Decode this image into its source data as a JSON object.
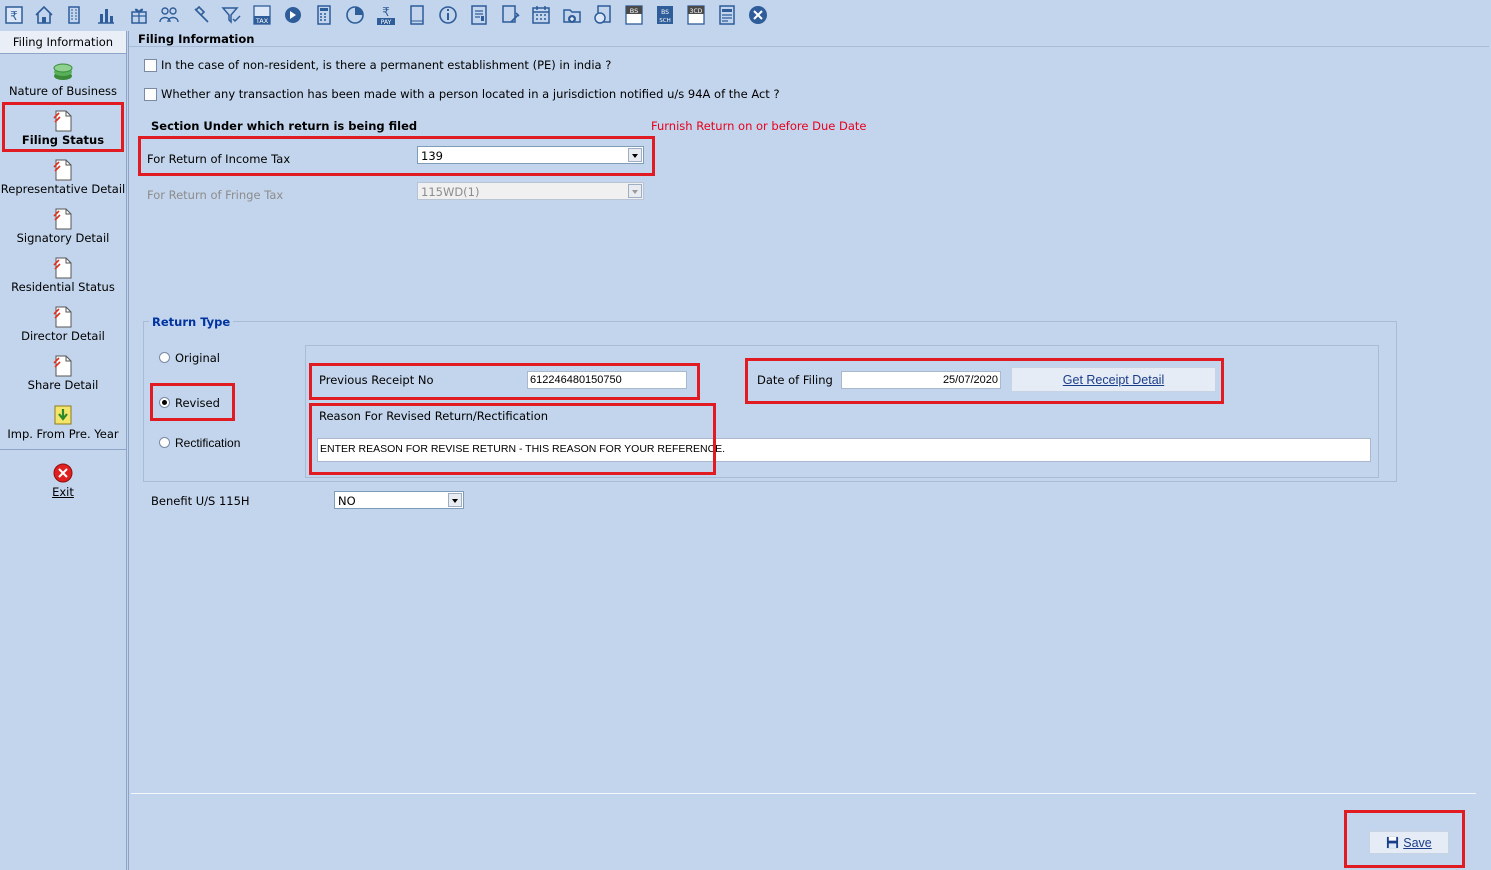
{
  "toolbar": {
    "icons": [
      "rupee-book-icon",
      "home-icon",
      "building-icon",
      "bar-chart-icon",
      "gift-icon",
      "group-icon",
      "hammer-icon",
      "funnel-check-icon",
      "tax-icon",
      "arrow-circle-icon",
      "calculator-icon",
      "pie-chart-icon",
      "pay-icon",
      "book-icon",
      "info-icon",
      "ledger-icon",
      "doc-pen-icon",
      "calendar-icon",
      "folder-add-icon",
      "doc-circle-icon",
      "bs-icon",
      "sch-icon",
      "3cd-icon",
      "form-icon",
      "close-icon"
    ],
    "texts": {
      "tax": "TAX",
      "pay": "PAY",
      "bs": "BS",
      "sch": "SCH",
      "cd3": "3CD"
    }
  },
  "sidebar": {
    "header": "Filing Information",
    "items": [
      {
        "label": "Nature of Business",
        "icon": "money-stack-icon"
      },
      {
        "label": "Filing Status",
        "icon": "document-icon",
        "active": true
      },
      {
        "label": "Representative Detail",
        "icon": "document-icon"
      },
      {
        "label": "Signatory Detail",
        "icon": "document-icon"
      },
      {
        "label": "Residential Status",
        "icon": "document-icon"
      },
      {
        "label": "Director Detail",
        "icon": "document-icon"
      },
      {
        "label": "Share Detail",
        "icon": "document-icon"
      },
      {
        "label": "Imp. From Pre. Year",
        "icon": "import-icon"
      }
    ],
    "exit_label": "Exit"
  },
  "main": {
    "group_title": "Filing Information",
    "q1": "In the case of non-resident, is there a permanent establishment (PE) in india ?",
    "q2": "Whether any transaction has been made with a person located in a jurisdiction notified u/s 94A of the Act ?",
    "section_heading": "Section Under which return is being filed",
    "due_note": "Furnish Return on or before Due Date",
    "income_tax_label": "For Return of Income Tax",
    "income_tax_value": "139",
    "fringe_tax_label": "For Return of Fringe Tax",
    "fringe_tax_value": "115WD(1)",
    "return_type": {
      "title": "Return Type",
      "options": [
        "Original",
        "Revised",
        "Rectification"
      ],
      "selected": "Revised"
    },
    "prev_receipt_label": "Previous Receipt No",
    "prev_receipt_value": "612246480150750",
    "date_label": "Date of Filing",
    "date_value": "25/07/2020",
    "get_receipt_label": "Get Receipt Detail",
    "reason_label": "Reason For Revised Return/Rectification",
    "reason_value": "ENTER REASON FOR REVISE RETURN - THIS REASON FOR YOUR REFERENCE.",
    "benefit_label": "Benefit U/S 115H",
    "benefit_value": "NO",
    "save_label": "Save"
  },
  "colors": {
    "background": "#c3d5ec",
    "highlight": "#e11b22",
    "note": "#e8001c",
    "legend_blue": "#0033a0"
  }
}
